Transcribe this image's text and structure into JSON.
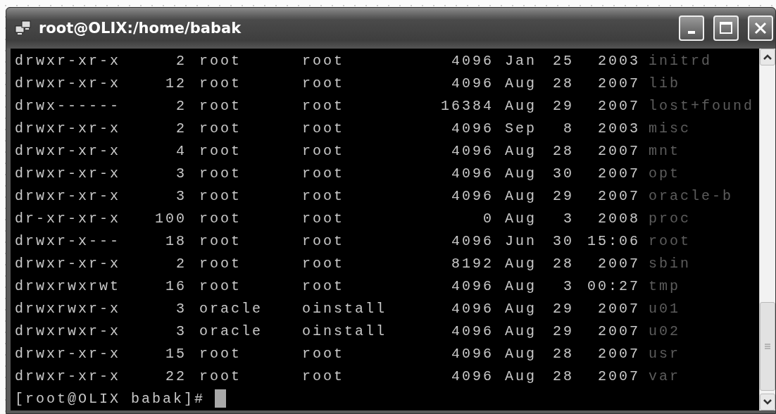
{
  "window": {
    "title": "root@OLIX:/home/babak"
  },
  "listing": [
    {
      "permissions": "drwxr-xr-x",
      "links": "2",
      "owner": "root",
      "group": "root",
      "size": "4096",
      "month": "Jan",
      "day": "25",
      "time": "2003",
      "name": "initrd"
    },
    {
      "permissions": "drwxr-xr-x",
      "links": "12",
      "owner": "root",
      "group": "root",
      "size": "4096",
      "month": "Aug",
      "day": "28",
      "time": "2007",
      "name": "lib"
    },
    {
      "permissions": "drwx------",
      "links": "2",
      "owner": "root",
      "group": "root",
      "size": "16384",
      "month": "Aug",
      "day": "29",
      "time": "2007",
      "name": "lost+found"
    },
    {
      "permissions": "drwxr-xr-x",
      "links": "2",
      "owner": "root",
      "group": "root",
      "size": "4096",
      "month": "Sep",
      "day": "8",
      "time": "2003",
      "name": "misc"
    },
    {
      "permissions": "drwxr-xr-x",
      "links": "4",
      "owner": "root",
      "group": "root",
      "size": "4096",
      "month": "Aug",
      "day": "28",
      "time": "2007",
      "name": "mnt"
    },
    {
      "permissions": "drwxr-xr-x",
      "links": "3",
      "owner": "root",
      "group": "root",
      "size": "4096",
      "month": "Aug",
      "day": "30",
      "time": "2007",
      "name": "opt"
    },
    {
      "permissions": "drwxr-xr-x",
      "links": "3",
      "owner": "root",
      "group": "root",
      "size": "4096",
      "month": "Aug",
      "day": "29",
      "time": "2007",
      "name": "oracle-b"
    },
    {
      "permissions": "dr-xr-xr-x",
      "links": "100",
      "owner": "root",
      "group": "root",
      "size": "0",
      "month": "Aug",
      "day": "3",
      "time": "2008",
      "name": "proc"
    },
    {
      "permissions": "drwxr-x---",
      "links": "18",
      "owner": "root",
      "group": "root",
      "size": "4096",
      "month": "Jun",
      "day": "30",
      "time": "15:06",
      "name": "root"
    },
    {
      "permissions": "drwxr-xr-x",
      "links": "2",
      "owner": "root",
      "group": "root",
      "size": "8192",
      "month": "Aug",
      "day": "28",
      "time": "2007",
      "name": "sbin"
    },
    {
      "permissions": "drwxrwxrwt",
      "links": "16",
      "owner": "root",
      "group": "root",
      "size": "4096",
      "month": "Aug",
      "day": "3",
      "time": "00:27",
      "name": "tmp"
    },
    {
      "permissions": "drwxrwxr-x",
      "links": "3",
      "owner": "oracle",
      "group": "oinstall",
      "size": "4096",
      "month": "Aug",
      "day": "29",
      "time": "2007",
      "name": "u01"
    },
    {
      "permissions": "drwxrwxr-x",
      "links": "3",
      "owner": "oracle",
      "group": "oinstall",
      "size": "4096",
      "month": "Aug",
      "day": "29",
      "time": "2007",
      "name": "u02"
    },
    {
      "permissions": "drwxr-xr-x",
      "links": "15",
      "owner": "root",
      "group": "root",
      "size": "4096",
      "month": "Aug",
      "day": "28",
      "time": "2007",
      "name": "usr"
    },
    {
      "permissions": "drwxr-xr-x",
      "links": "22",
      "owner": "root",
      "group": "root",
      "size": "4096",
      "month": "Aug",
      "day": "28",
      "time": "2007",
      "name": "var"
    }
  ],
  "prompt": "[root@OLIX babak]#"
}
